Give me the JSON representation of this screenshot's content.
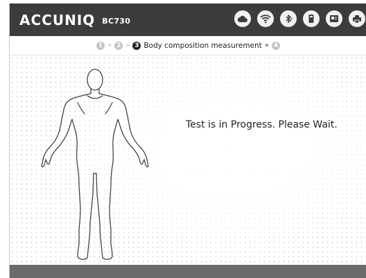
{
  "header": {
    "brand": "ACCUNIQ",
    "model": "BC730",
    "status_icons": [
      "cloud-icon",
      "wifi-icon",
      "bluetooth-icon",
      "device-icon",
      "id-card-icon",
      "printer-icon"
    ]
  },
  "steps": {
    "items": [
      {
        "number": "1",
        "label": "",
        "active": false
      },
      {
        "number": "2",
        "label": "",
        "active": false
      },
      {
        "number": "3",
        "label": "Body composition measurement",
        "active": true
      },
      {
        "number": "4",
        "label": "",
        "active": false
      }
    ],
    "separator": "»"
  },
  "main": {
    "message": "Test is in Progress. Please Wait."
  },
  "colors": {
    "topbar": "#3c3c3e",
    "footer": "#6b6b6b",
    "step_inactive": "#c4c4c4",
    "step_active": "#222222"
  }
}
